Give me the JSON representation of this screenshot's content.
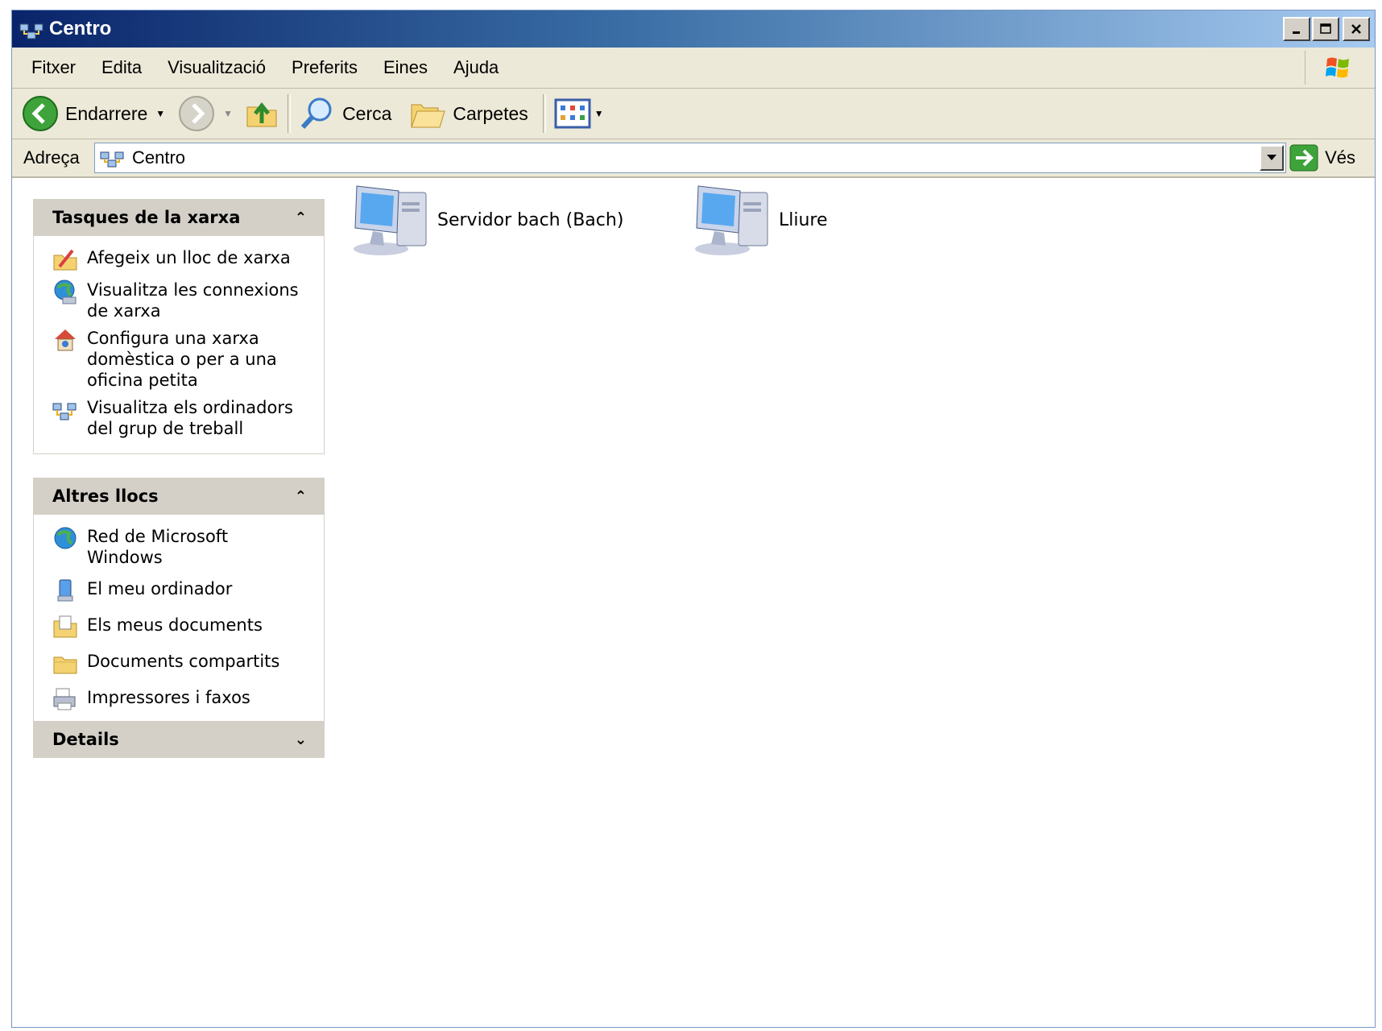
{
  "window": {
    "title": "Centro"
  },
  "menu": [
    "Fitxer",
    "Edita",
    "Visualització",
    "Preferits",
    "Eines",
    "Ajuda"
  ],
  "toolbar": {
    "back": "Endarrere",
    "search": "Cerca",
    "folders": "Carpetes"
  },
  "address": {
    "label": "Adreça",
    "value": "Centro",
    "go": "Vés"
  },
  "network_tasks": {
    "title": "Tasques de la xarxa",
    "items": [
      "Afegeix un lloc de xarxa",
      "Visualitza les connexions de xarxa",
      "Configura una xarxa domèstica o per a una oficina petita",
      "Visualitza els ordinadors del grup de treball"
    ]
  },
  "other_places": {
    "title": "Altres llocs",
    "items": [
      "Red de Microsoft Windows",
      "El meu ordinador",
      "Els meus documents",
      "Documents compartits",
      "Impressores i faxos"
    ]
  },
  "details": {
    "title": "Details"
  },
  "content": {
    "items": [
      {
        "label": "Servidor bach (Bach)",
        "icon": "computer-icon"
      },
      {
        "label": "Lliure",
        "icon": "computer-icon"
      }
    ]
  },
  "colors": {
    "titlebar_start": "#0a246a",
    "titlebar_end": "#a6caf0",
    "chrome": "#ece9d8",
    "panel_header": "#d4d0c8"
  }
}
